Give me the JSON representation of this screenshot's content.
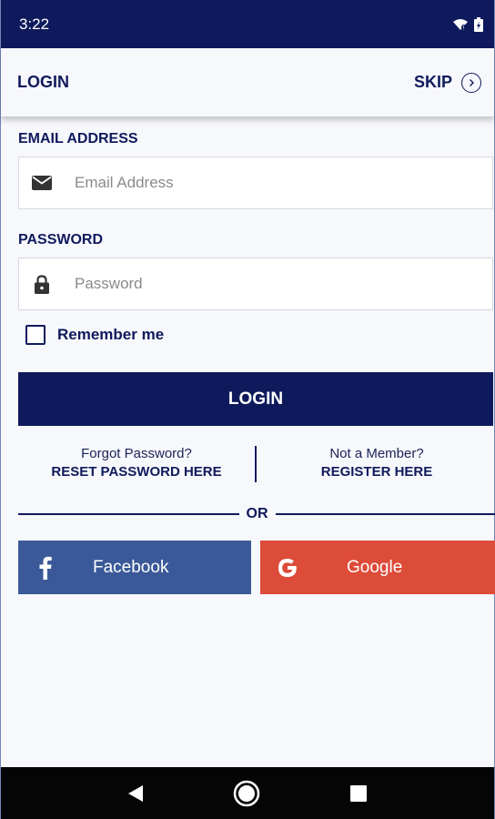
{
  "status_bar": {
    "time": "3:22"
  },
  "header": {
    "title": "LOGIN",
    "skip_label": "SKIP"
  },
  "form": {
    "email": {
      "label": "EMAIL ADDRESS",
      "placeholder": "Email Address",
      "value": ""
    },
    "password": {
      "label": "PASSWORD",
      "placeholder": "Password",
      "value": ""
    },
    "remember_label": "Remember me",
    "remember_checked": false,
    "login_label": "LOGIN"
  },
  "links": {
    "forgot_top": "Forgot Password?",
    "forgot_bottom": "RESET PASSWORD HERE",
    "member_top": "Not a Member?",
    "member_bottom": "REGISTER HERE"
  },
  "divider_text": "OR",
  "social": {
    "facebook": {
      "label": "Facebook",
      "icon": "facebook-icon",
      "color": "#3b5998"
    },
    "google": {
      "label": "Google",
      "icon": "google-icon",
      "color": "#dd4b39"
    }
  },
  "colors": {
    "primary": "#0f1a5c",
    "background": "#f7f8fc"
  }
}
